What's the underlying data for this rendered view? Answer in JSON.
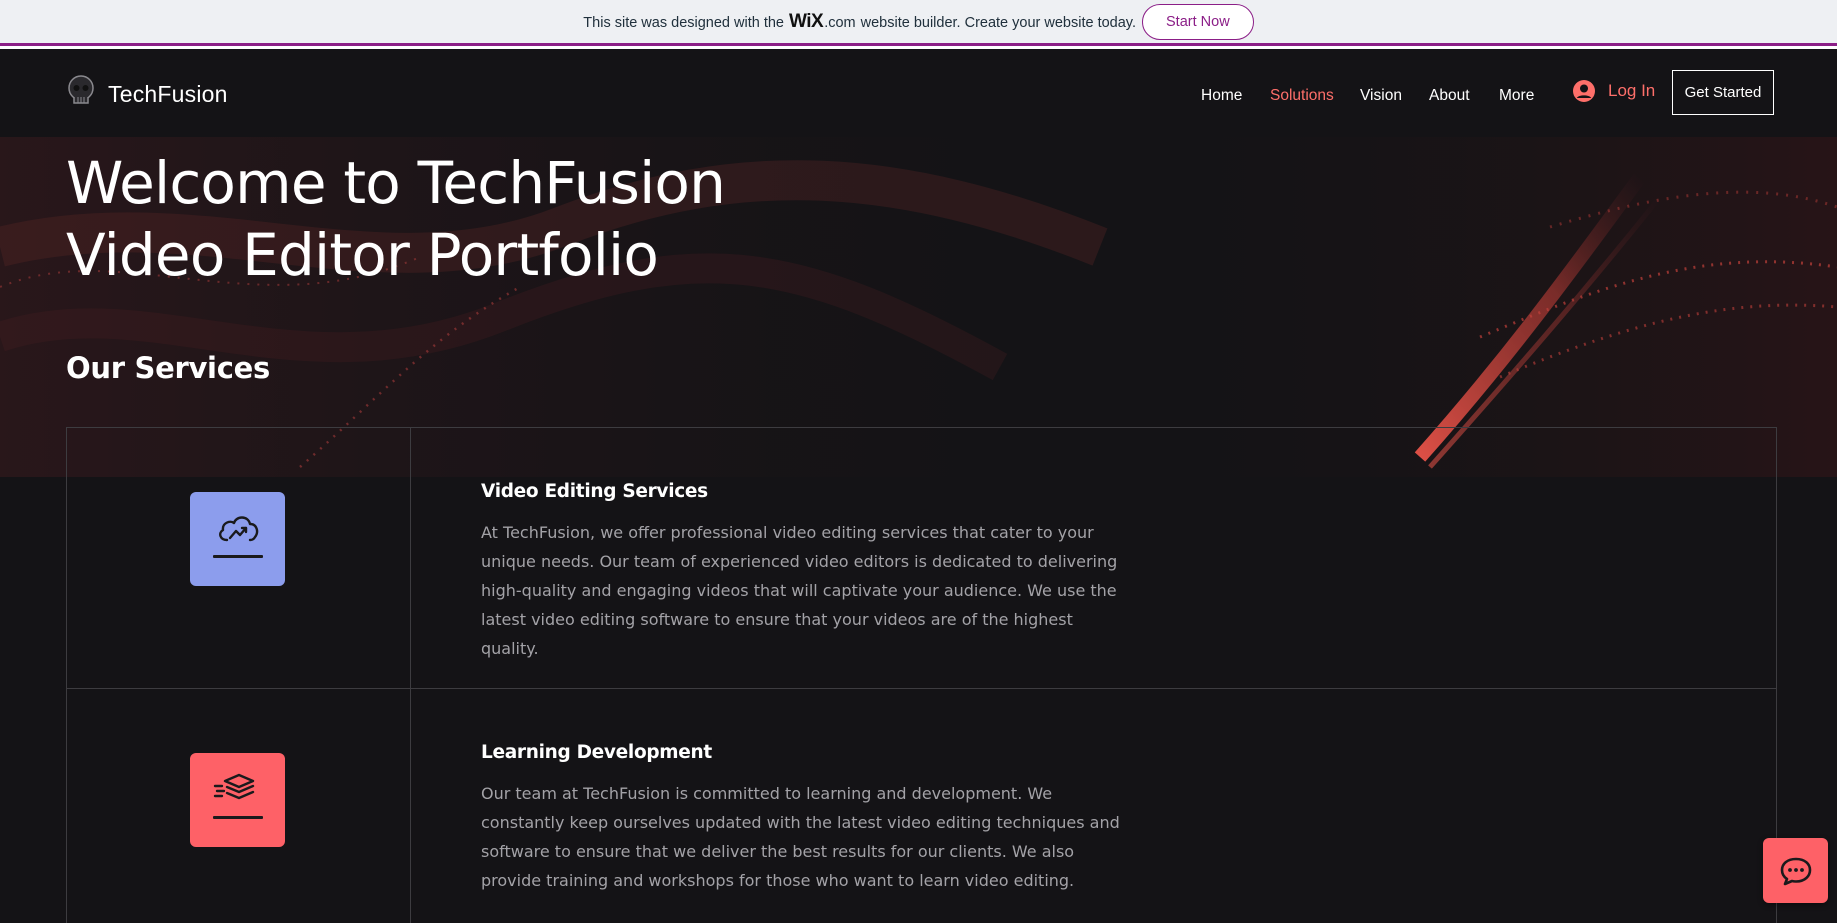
{
  "banner": {
    "text_before": "This site was designed with the",
    "wix_logo": "WiX",
    "text_dotcom": ".com",
    "text_after": "website builder. Create your website today.",
    "cta_label": "Start Now"
  },
  "header": {
    "brand": "TechFusion",
    "nav": [
      "Home",
      "Solutions",
      "Vision",
      "About",
      "More"
    ],
    "active_nav": "Solutions",
    "login_label": "Log In",
    "cta_label": "Get Started"
  },
  "hero": {
    "title_line1": "Welcome to TechFusion",
    "title_line2": "Video Editor Portfolio"
  },
  "services": {
    "heading": "Our Services",
    "items": [
      {
        "title": "Video Editing Services",
        "description": "At TechFusion, we offer professional video editing services that cater to your unique needs. Our team of experienced video editors is dedicated to delivering high-quality and engaging videos that will captivate your audience. We use the latest video editing software to ensure that your videos are of the highest quality.",
        "icon": "cloud-growth-icon",
        "icon_color": "#8c9ded"
      },
      {
        "title": "Learning Development",
        "description": "Our team at TechFusion is committed to learning and development. We constantly keep ourselves updated with the latest video editing techniques and software to ensure that we deliver the best results for our clients. We also provide training and workshops for those who want to learn video editing.",
        "icon": "stacked-layers-icon",
        "icon_color": "#fe6167"
      }
    ]
  },
  "colors": {
    "background": "#141316",
    "accent": "#fe6f6a",
    "wix_purple": "#8b1e87",
    "text_muted": "#a3a2a7"
  },
  "chat": {
    "icon": "chat-icon"
  }
}
